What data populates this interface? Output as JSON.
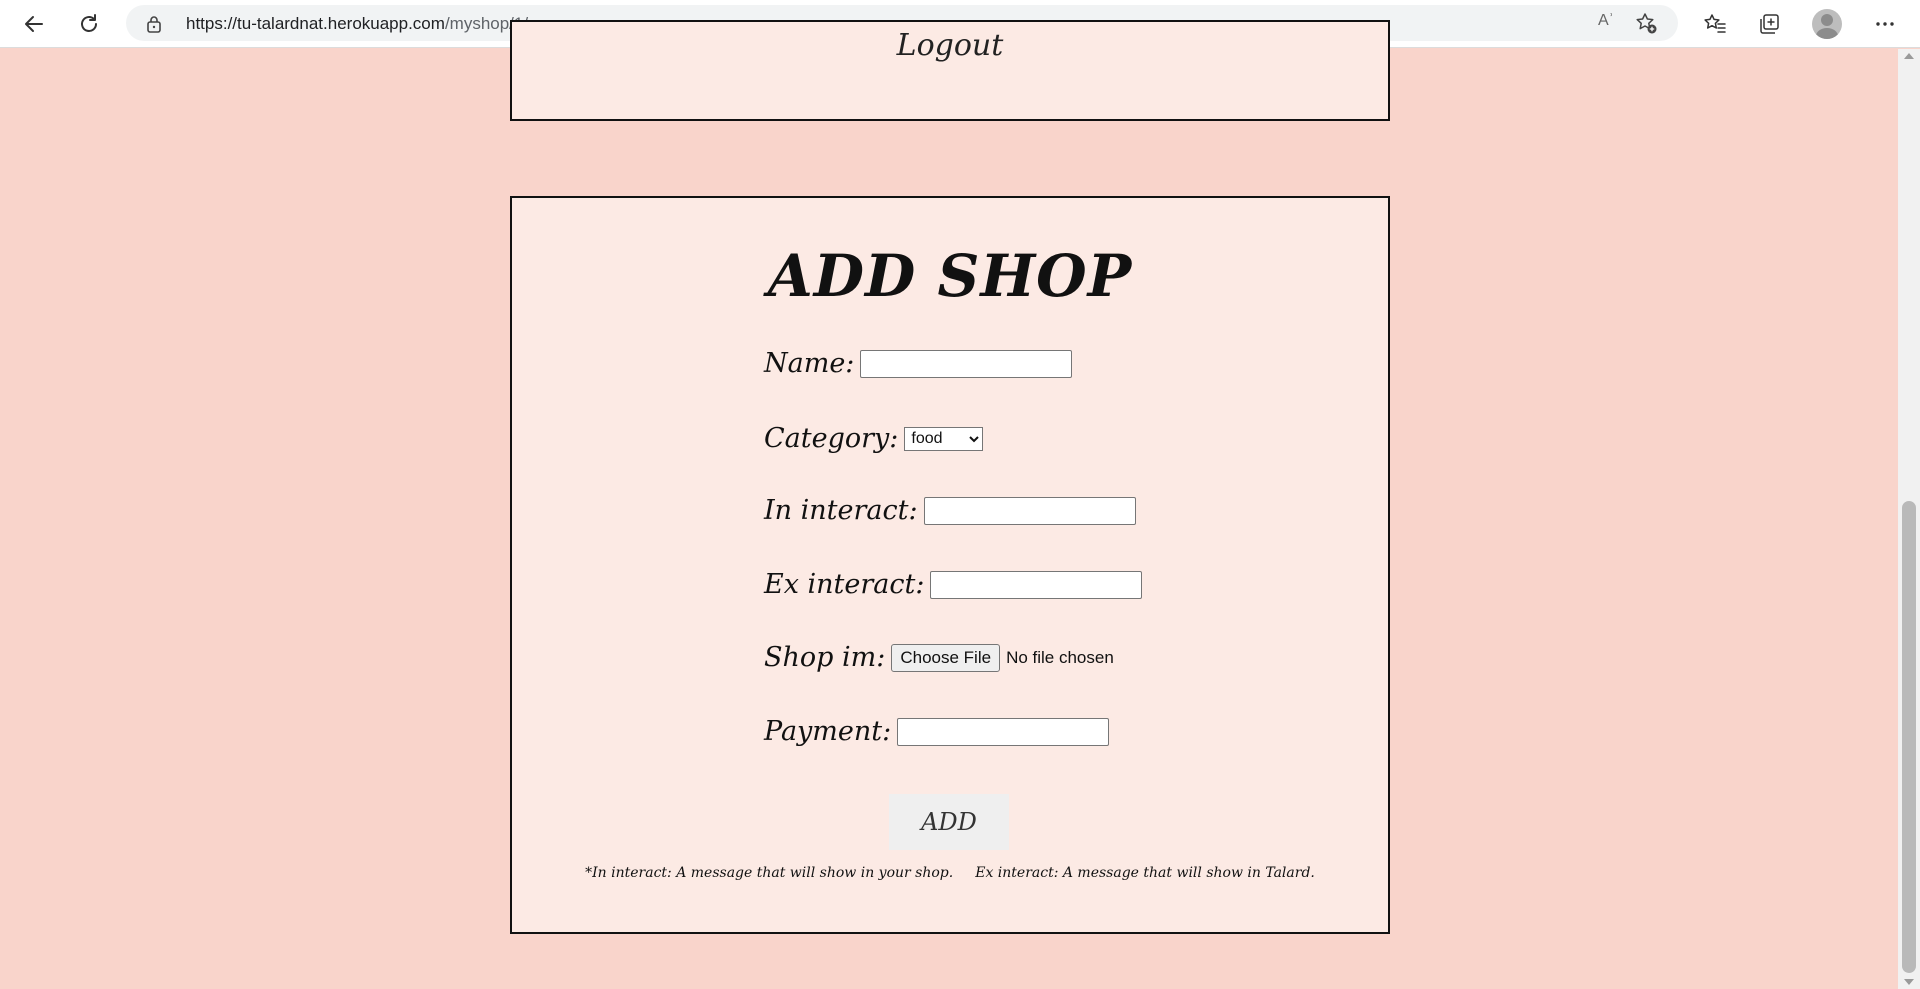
{
  "browser": {
    "url_host": "https://tu-talardnat.herokuapp.com",
    "url_path": "/myshop/1/",
    "read_aloud_label": "Aʾ"
  },
  "logout": {
    "label": "Logout"
  },
  "form": {
    "title": "ADD SHOP",
    "name_label": "Name:",
    "name_value": "",
    "category_label": "Category:",
    "category_selected": "food",
    "in_interact_label": "In interact:",
    "in_interact_value": "",
    "ex_interact_label": "Ex interact:",
    "ex_interact_value": "",
    "shop_im_label": "Shop im:",
    "choose_file_label": "Choose File",
    "no_file_text": "No file chosen",
    "payment_label": "Payment:",
    "payment_value": "",
    "add_button": "ADD",
    "note_in": "*In interact: A message that will show in your shop.",
    "note_ex": "Ex interact: A message that will show in Talard."
  }
}
